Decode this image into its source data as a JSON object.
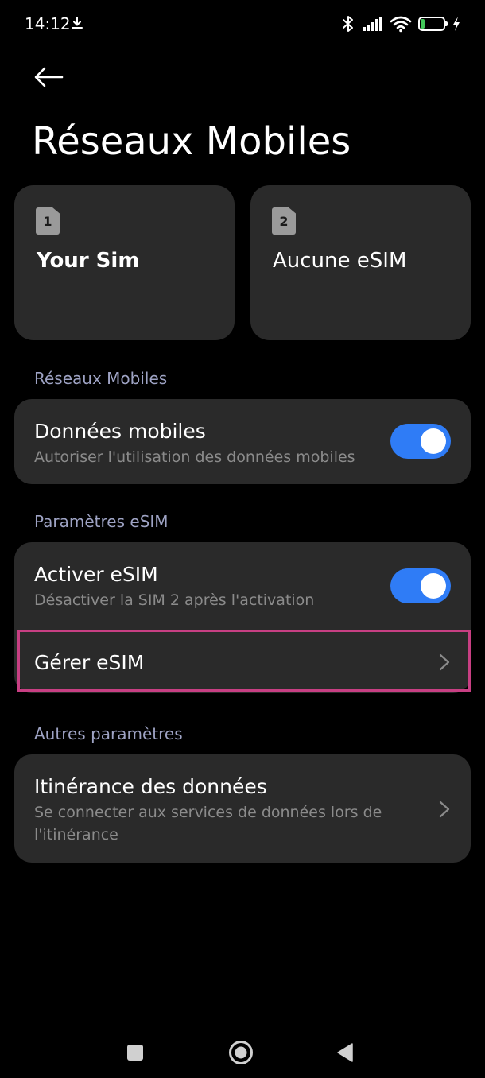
{
  "status_bar": {
    "time": "14:12",
    "battery_level": "19",
    "icons": [
      "download-icon",
      "bluetooth-icon",
      "signal-icon",
      "wifi-icon",
      "battery-icon",
      "charging-icon"
    ]
  },
  "header": {
    "back_icon": "arrow-left-icon",
    "title": "Réseaux Mobiles"
  },
  "sim_cards": [
    {
      "slot": "1",
      "name": "Your Sim"
    },
    {
      "slot": "2",
      "name": "Aucune eSIM"
    }
  ],
  "sections": {
    "mobile_networks": {
      "header": "Réseaux Mobiles",
      "mobile_data": {
        "title": "Données mobiles",
        "subtitle": "Autoriser l'utilisation des données mobiles",
        "enabled": true
      }
    },
    "esim_settings": {
      "header": "Paramètres eSIM",
      "activate_esim": {
        "title": "Activer eSIM",
        "subtitle": "Désactiver la SIM 2 après l'activation",
        "enabled": true
      },
      "manage_esim": {
        "title": "Gérer eSIM"
      }
    },
    "other_settings": {
      "header": "Autres paramètres",
      "data_roaming": {
        "title": "Itinérance des données",
        "subtitle_line1": "Se connecter aux services de données lors de",
        "subtitle_line2": "l'itinérance"
      }
    }
  },
  "colors": {
    "background": "#000000",
    "card": "#2a2a2a",
    "accent": "#2f7cf6",
    "section_header": "#9ea3c4",
    "subtitle": "#8b8b8b",
    "highlight": "#c83f83",
    "battery_fill": "#43c95a"
  },
  "nav_bar": {
    "icons": [
      "recent-apps-icon",
      "home-icon",
      "back-triangle-icon"
    ]
  }
}
